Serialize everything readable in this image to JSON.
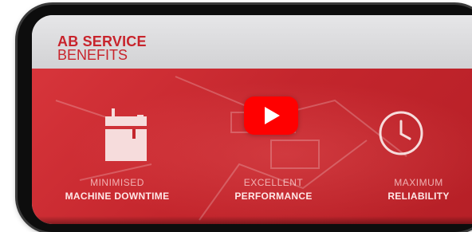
{
  "header": {
    "brand_line1": "AB SERVICE",
    "brand_line2": "BENEFITS",
    "brand_color": "#c8242c"
  },
  "hero": {
    "background_color": "#c4262d",
    "benefits": [
      {
        "small": "MINIMISED",
        "big": "MACHINE DOWNTIME",
        "icon": "machine-icon"
      },
      {
        "small": "EXCELLENT",
        "big": "PERFORMANCE",
        "icon": ""
      },
      {
        "small": "MAXIMUM",
        "big": "RELIABILITY",
        "icon": "clock-icon"
      }
    ]
  },
  "video": {
    "play_button_color": "#ff0000",
    "play_icon": "play-icon"
  }
}
